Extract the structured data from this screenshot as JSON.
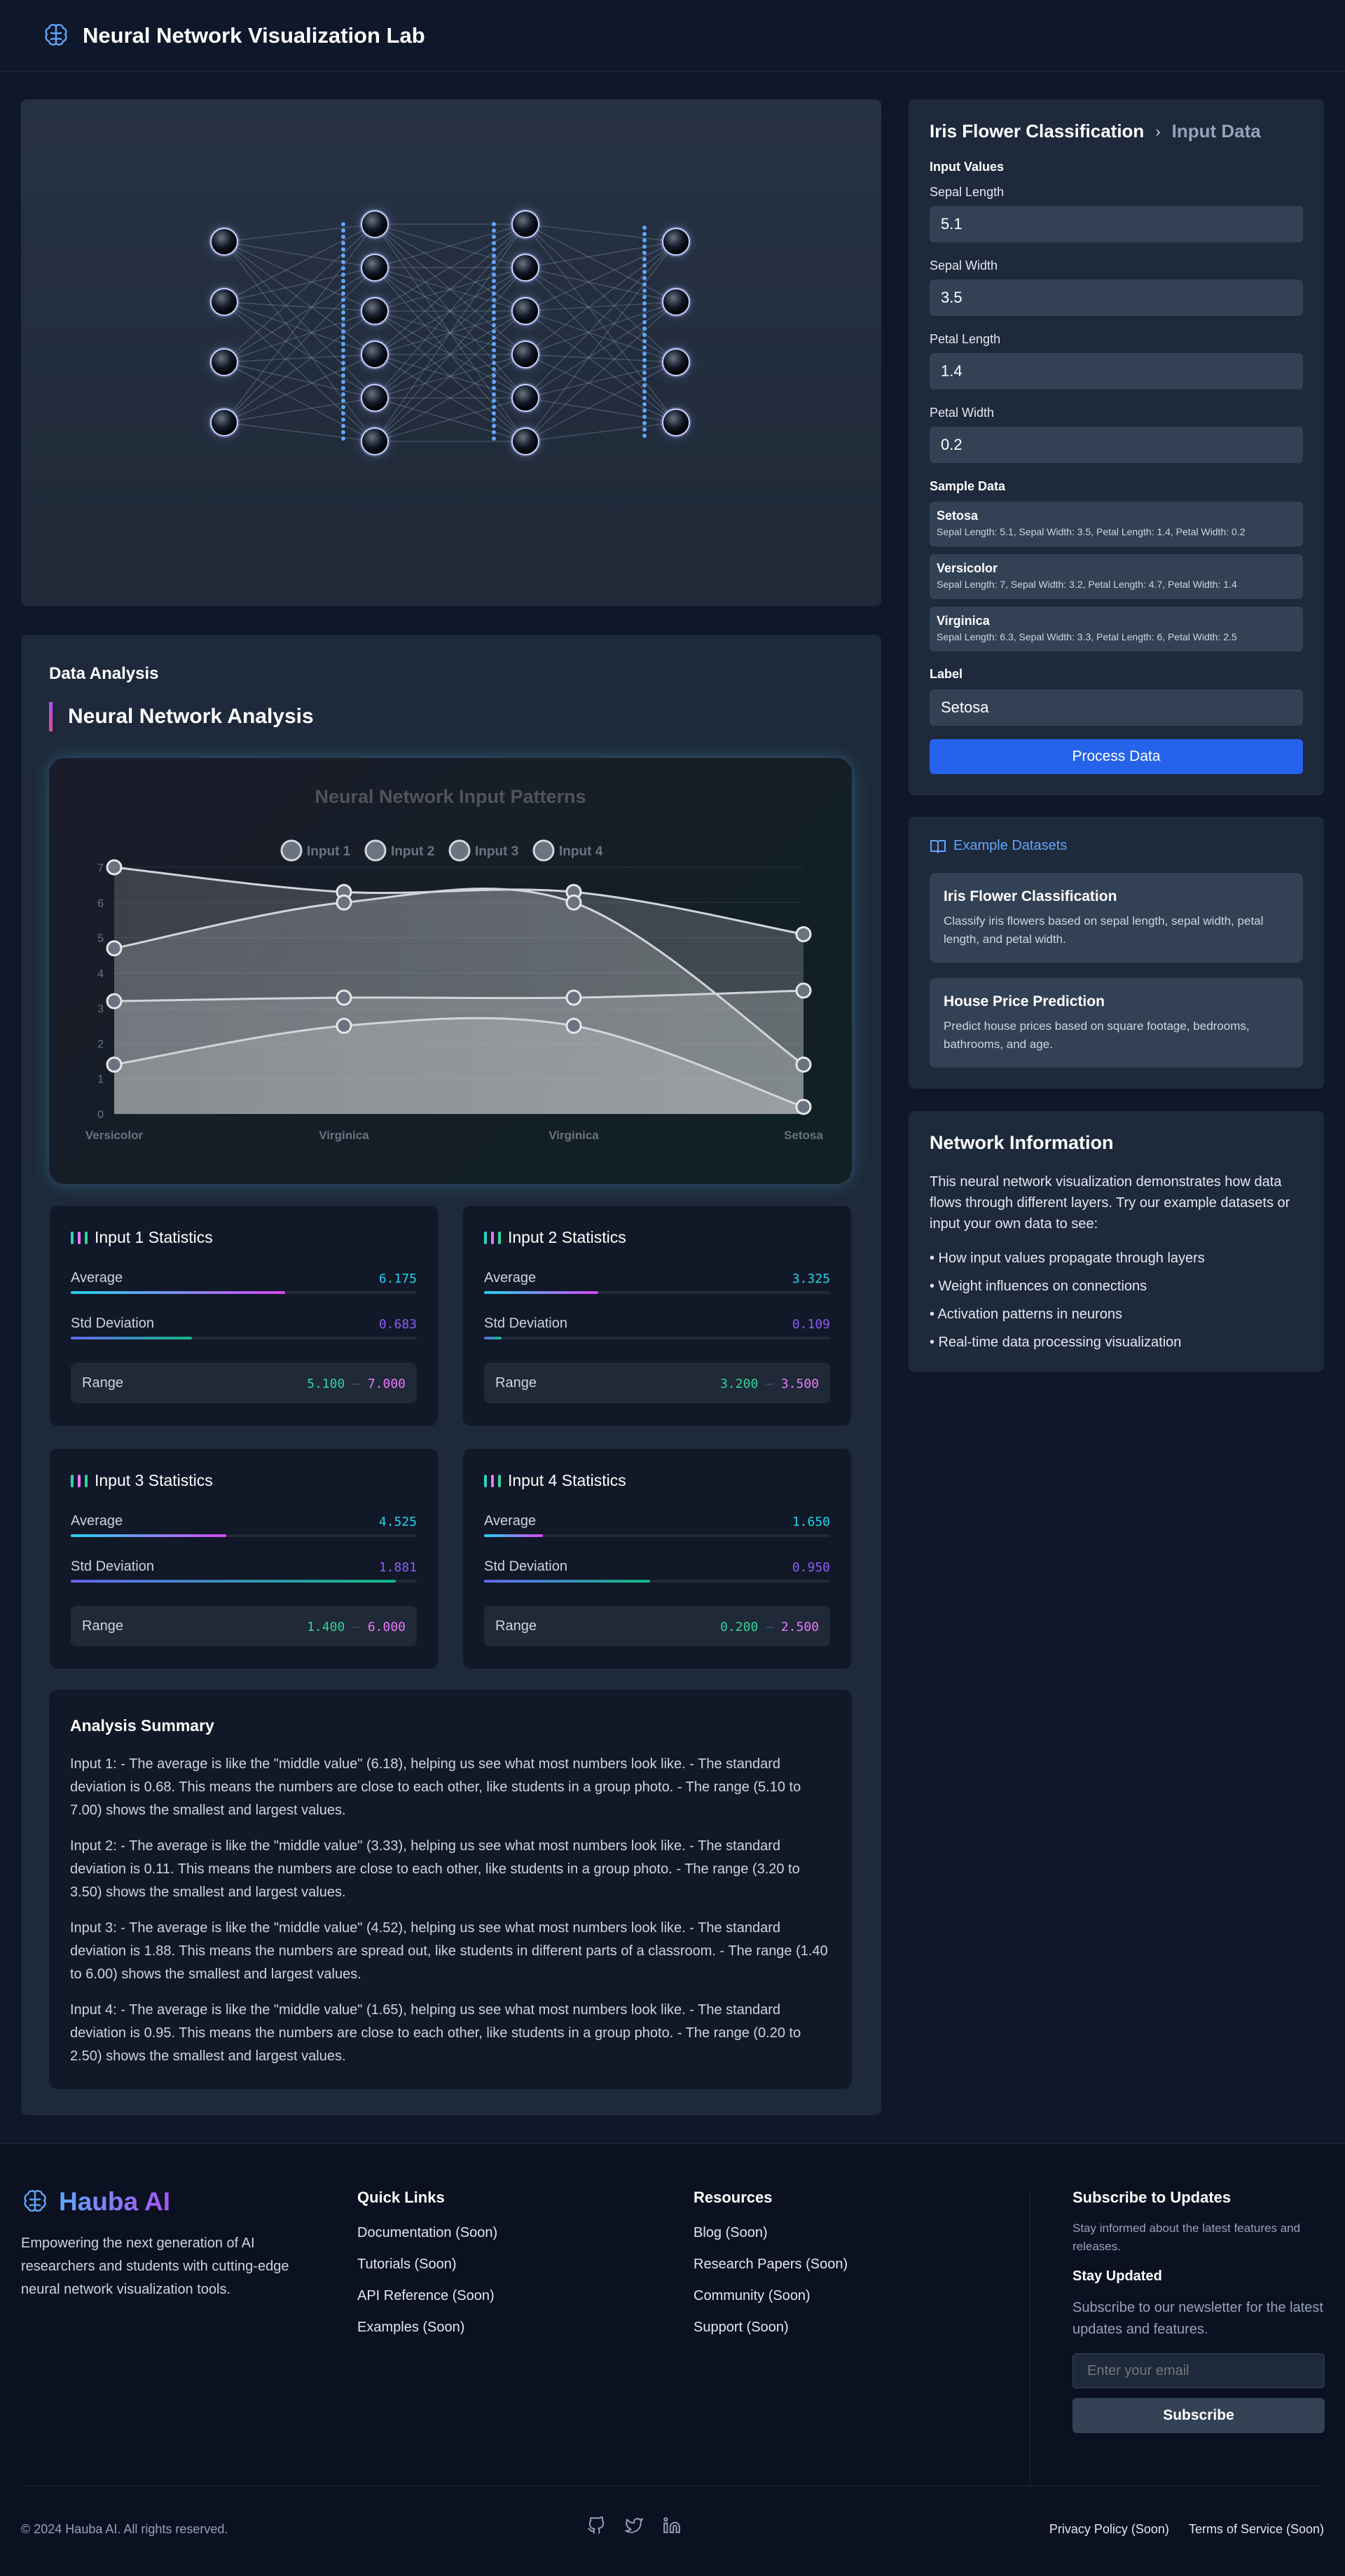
{
  "header": {
    "title": "Neural Network Visualization Lab",
    "icon": "brain-icon"
  },
  "network": {
    "layers": [
      4,
      6,
      6,
      4
    ]
  },
  "analysis": {
    "section_title": "Data Analysis",
    "title": "Neural Network Analysis"
  },
  "chart_data": {
    "type": "area",
    "title": "Neural Network Input Patterns",
    "categories": [
      "Versicolor",
      "Virginica",
      "Virginica",
      "Setosa"
    ],
    "ylim": [
      0,
      7
    ],
    "yticks": [
      0,
      1,
      2,
      3,
      4,
      5,
      6,
      7
    ],
    "legend_position": "top",
    "series": [
      {
        "name": "Input 1",
        "values": [
          7,
          6.3,
          6.3,
          5.1
        ],
        "color": "#94a3b8"
      },
      {
        "name": "Input 2",
        "values": [
          3.2,
          3.3,
          3.3,
          3.5
        ],
        "color": "#a3a3a3"
      },
      {
        "name": "Input 3",
        "values": [
          4.7,
          6,
          6,
          1.4
        ],
        "color": "#9ca3af"
      },
      {
        "name": "Input 4",
        "values": [
          1.4,
          2.5,
          2.5,
          0.2
        ],
        "color": "#a1a1aa"
      }
    ]
  },
  "stats": [
    {
      "title": "Input 1 Statistics",
      "avg_label": "Average",
      "avg": "6.175",
      "avg_fill": 0.62,
      "std_label": "Std Deviation",
      "std": "0.683",
      "std_fill": 0.35,
      "range_label": "Range",
      "min": "5.100",
      "sep": "—",
      "max": "7.000"
    },
    {
      "title": "Input 2 Statistics",
      "avg_label": "Average",
      "avg": "3.325",
      "avg_fill": 0.33,
      "std_label": "Std Deviation",
      "std": "0.109",
      "std_fill": 0.05,
      "range_label": "Range",
      "min": "3.200",
      "sep": "—",
      "max": "3.500"
    },
    {
      "title": "Input 3 Statistics",
      "avg_label": "Average",
      "avg": "4.525",
      "avg_fill": 0.45,
      "std_label": "Std Deviation",
      "std": "1.881",
      "std_fill": 0.94,
      "range_label": "Range",
      "min": "1.400",
      "sep": "—",
      "max": "6.000"
    },
    {
      "title": "Input 4 Statistics",
      "avg_label": "Average",
      "avg": "1.650",
      "avg_fill": 0.17,
      "std_label": "Std Deviation",
      "std": "0.950",
      "std_fill": 0.48,
      "range_label": "Range",
      "min": "0.200",
      "sep": "—",
      "max": "2.500"
    }
  ],
  "summary": {
    "title": "Analysis Summary",
    "paragraphs": [
      "Input 1: - The average is like the \"middle value\" (6.18), helping us see what most numbers look like. - The standard deviation is 0.68. This means the numbers are close to each other, like students in a group photo. - The range (5.10 to 7.00) shows the smallest and largest values.",
      "Input 2: - The average is like the \"middle value\" (3.33), helping us see what most numbers look like. - The standard deviation is 0.11. This means the numbers are close to each other, like students in a group photo. - The range (3.20 to 3.50) shows the smallest and largest values.",
      "Input 3: - The average is like the \"middle value\" (4.52), helping us see what most numbers look like. - The standard deviation is 1.88. This means the numbers are spread out, like students in different parts of a classroom. - The range (1.40 to 6.00) shows the smallest and largest values.",
      "Input 4: - The average is like the \"middle value\" (1.65), helping us see what most numbers look like. - The standard deviation is 0.95. This means the numbers are close to each other, like students in a group photo. - The range (0.20 to 2.50) shows the smallest and largest values."
    ]
  },
  "form": {
    "breadcrumb": [
      "Iris Flower Classification",
      "›",
      "Input Data"
    ],
    "input_values_label": "Input Values",
    "fields": [
      {
        "label": "Sepal Length",
        "value": "5.1"
      },
      {
        "label": "Sepal Width",
        "value": "3.5"
      },
      {
        "label": "Petal Length",
        "value": "1.4"
      },
      {
        "label": "Petal Width",
        "value": "0.2"
      }
    ],
    "sample_label": "Sample Data",
    "samples": [
      {
        "name": "Setosa",
        "desc": "Sepal Length: 5.1, Sepal Width: 3.5, Petal Length: 1.4, Petal Width: 0.2"
      },
      {
        "name": "Versicolor",
        "desc": "Sepal Length: 7, Sepal Width: 3.2, Petal Length: 4.7, Petal Width: 1.4"
      },
      {
        "name": "Virginica",
        "desc": "Sepal Length: 6.3, Sepal Width: 3.3, Petal Length: 6, Petal Width: 2.5"
      }
    ],
    "label_label": "Label",
    "label_value": "Setosa",
    "process_button": "Process Data"
  },
  "examples": {
    "title": "Example Datasets",
    "icon": "book-open-icon",
    "items": [
      {
        "title": "Iris Flower Classification",
        "desc": "Classify iris flowers based on sepal length, sepal width, petal length, and petal width."
      },
      {
        "title": "House Price Prediction",
        "desc": "Predict house prices based on square footage, bedrooms, bathrooms, and age."
      }
    ]
  },
  "netinfo": {
    "title": "Network Information",
    "intro": "This neural network visualization demonstrates how data flows through different layers. Try our example datasets or input your own data to see:",
    "bullets": [
      "• How input values propagate through layers",
      "• Weight influences on connections",
      "• Activation patterns in neurons",
      "• Real-time data processing visualization"
    ]
  },
  "footer": {
    "brand": "Hauba AI",
    "tagline": "Empowering the next generation of AI researchers and students with cutting-edge neural network visualization tools.",
    "quick_links_title": "Quick Links",
    "quick_links": [
      "Documentation (Soon)",
      "Tutorials (Soon)",
      "API Reference (Soon)",
      "Examples (Soon)"
    ],
    "resources_title": "Resources",
    "resources": [
      "Blog (Soon)",
      "Research Papers (Soon)",
      "Community (Soon)",
      "Support (Soon)"
    ],
    "subscribe_title": "Subscribe to Updates",
    "subscribe_desc": "Stay informed about the latest features and releases.",
    "stay_title": "Stay Updated",
    "stay_desc": "Subscribe to our newsletter for the latest updates and features.",
    "email_placeholder": "Enter your email",
    "subscribe_button": "Subscribe",
    "copyright": "© 2024 Hauba AI. All rights reserved.",
    "social": [
      "github-icon",
      "twitter-icon",
      "linkedin-icon"
    ],
    "legal": [
      "Privacy Policy (Soon)",
      "Terms of Service (Soon)"
    ]
  }
}
